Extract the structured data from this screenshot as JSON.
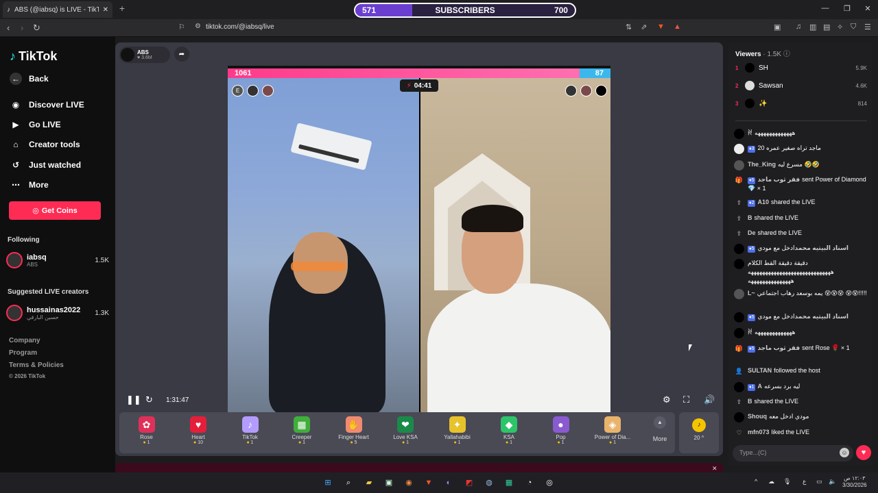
{
  "browser": {
    "tab_title": "ABS (@iabsq) is LIVE - TikTok",
    "tab_close": "✕",
    "new_tab": "+",
    "url": "tiktok.com/@iabsq/live"
  },
  "overlay": {
    "subscribers_label": "SUBSCRIBERS",
    "current": "571",
    "goal": "700",
    "progress": 0.26
  },
  "sidebar": {
    "logo": "TikTok",
    "nav": [
      {
        "label": "Back",
        "icon": "back-arrow-icon"
      },
      {
        "label": "Discover LIVE",
        "icon": "live-icon"
      },
      {
        "label": "Go LIVE",
        "icon": "camera-icon"
      },
      {
        "label": "Creator tools",
        "icon": "house-icon"
      },
      {
        "label": "Just watched",
        "icon": "history-icon"
      },
      {
        "label": "More",
        "icon": "dots-icon"
      }
    ],
    "get_coins": "Get Coins",
    "following_title": "Following",
    "following": [
      {
        "name": "iabsq",
        "sub": "ABS",
        "count": "1.5K"
      }
    ],
    "suggested_title": "Suggested LIVE creators",
    "suggested": [
      {
        "name": "hussainas2022",
        "sub": "حسين البارقي",
        "count": "1.3K"
      }
    ],
    "footer": [
      "Company",
      "Program",
      "Terms & Policies",
      "© 2026 TikTok"
    ]
  },
  "stream": {
    "host_name": "ABS",
    "host_followers": "3.6M",
    "pk_left_score": "1061",
    "pk_right_score": "87",
    "pk_left_share": 0.92,
    "battle_timer": "04:41",
    "left_avatars": [
      "E",
      "",
      ""
    ],
    "elapsed": "1:31:47"
  },
  "gifts": [
    {
      "name": "Rose",
      "price": "1",
      "color": "#e0305a",
      "glyph": "✿"
    },
    {
      "name": "Heart",
      "price": "10",
      "color": "#e51f3a",
      "glyph": "♥"
    },
    {
      "name": "TikTok",
      "price": "1",
      "color": "#b49cff",
      "glyph": "♪"
    },
    {
      "name": "Creeper",
      "price": "1",
      "color": "#3fae3a",
      "glyph": "▦"
    },
    {
      "name": "Finger Heart",
      "price": "5",
      "color": "#f08a70",
      "glyph": "✋"
    },
    {
      "name": "Love KSA",
      "price": "1",
      "color": "#1a8a4a",
      "glyph": "❤"
    },
    {
      "name": "Yallahabibi",
      "price": "1",
      "color": "#e8c22a",
      "glyph": "✦"
    },
    {
      "name": "KSA",
      "price": "1",
      "color": "#2ec46a",
      "glyph": "◆"
    },
    {
      "name": "Pop",
      "price": "1",
      "color": "#8a5ad0",
      "glyph": "●"
    },
    {
      "name": "Power of Dia...",
      "price": "1",
      "color": "#e9b36b",
      "glyph": "◈"
    }
  ],
  "more_gifts": "More",
  "coin_balance": "20",
  "viewers": {
    "title": "Viewers",
    "count": "1.5K",
    "top": [
      {
        "rank": "1",
        "name": "SH",
        "value": "5.9K"
      },
      {
        "rank": "2",
        "name": "Sawsan",
        "value": "4.6K"
      },
      {
        "rank": "3",
        "name": "✨",
        "value": "814"
      }
    ]
  },
  "chat": [
    {
      "type": "msg",
      "user": "ꋊ",
      "badge": "",
      "text": "هههههههههههههه"
    },
    {
      "type": "msg",
      "user": "",
      "badge": "3",
      "text": "ماجد تراه صغير عمره 20"
    },
    {
      "type": "msg",
      "user": "The_King",
      "badge": "",
      "text": "مسرع ليه 🤣🤣"
    },
    {
      "type": "gift",
      "user": "فقر ثوب ماجد",
      "badge": "5",
      "text": "sent Power of Diamond 💎 × 1"
    },
    {
      "type": "share",
      "user": "A10",
      "badge": "2",
      "text": "shared the LIVE"
    },
    {
      "type": "share",
      "user": "B",
      "badge": "",
      "text": "shared the LIVE"
    },
    {
      "type": "share",
      "user": "De",
      "badge": "",
      "text": "shared the LIVE"
    },
    {
      "type": "msg",
      "user": "اسناد البيتيه محمد",
      "badge": "5",
      "text": "ادخل مع مودي"
    },
    {
      "type": "msg",
      "user": "",
      "badge": "",
      "text": "دقيقة دقيقة القط الكلام هههههههههههههههههههههههههههههه هههههههههههههههه"
    },
    {
      "type": "msg",
      "user": "L~",
      "badge": "",
      "text": "يمه بوسعد رهاب اجتماعي 😵😵😵 😵😵!!!!!"
    },
    {
      "type": "msg",
      "user": "اسناد البيتيه محمد",
      "badge": "5",
      "text": "ادخل مع مودي"
    },
    {
      "type": "msg",
      "user": "ꋊ",
      "badge": "",
      "text": "هههههههههههههه"
    },
    {
      "type": "gift",
      "user": "فقر ثوب ماجد",
      "badge": "5",
      "text": "sent Rose 🌹 × 1"
    },
    {
      "type": "follow",
      "user": "SULTAN",
      "badge": "",
      "text": "followed the host"
    },
    {
      "type": "msg",
      "user": "A",
      "badge": "1",
      "text": "ليه برد بسرعه"
    },
    {
      "type": "share",
      "user": "B",
      "badge": "",
      "text": "shared the LIVE"
    },
    {
      "type": "msg",
      "user": "Shouq",
      "badge": "",
      "text": "مودي ادخل معه"
    },
    {
      "type": "like",
      "user": "mfn073",
      "badge": "",
      "text": "liked the LIVE"
    }
  ],
  "chat_input": {
    "placeholder": "Type...(C)"
  },
  "taskbar": {
    "time": "١٢:٠٣ ص",
    "date": "3/30/2026",
    "lang": "ع"
  },
  "colors": {
    "accent": "#fe2c55",
    "badge": "#4c6ee8",
    "coin": "#f5c400"
  }
}
